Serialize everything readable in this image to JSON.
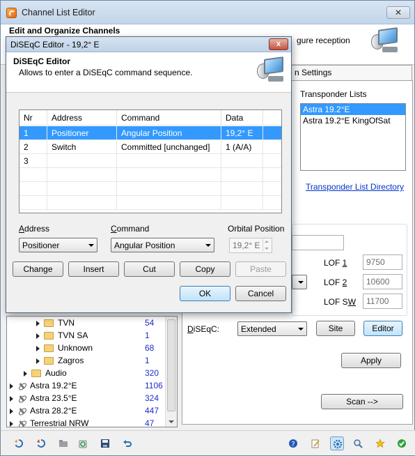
{
  "main": {
    "title": "Channel List Editor",
    "close_label": "✕",
    "header_title": "Edit and Organize Channels",
    "header_sub": "gure reception",
    "tab_label": "n Settings",
    "transponder_lists_label": "Transponder Lists",
    "transponder_lists": [
      "Astra 19.2°E",
      "Astra 19.2°E KingOfSat"
    ],
    "transponder_dir_link": "Transponder List Directory",
    "lof1_label_pre": "LOF ",
    "lof1_label_u": "1",
    "lof1_value": "9750",
    "lof2_label_pre": "LOF ",
    "lof2_label_u": "2",
    "lof2_value": "10600",
    "lofsw_label_pre": "LOF S",
    "lofsw_label_u": "W",
    "lofsw_value": "11700",
    "diseqc_label_u": "D",
    "diseqc_label_rest": "iSEqC:",
    "diseqc_value": "Extended",
    "site_button": "Site",
    "editor_button": "Editor",
    "apply_button": "Apply",
    "scan_button": "Scan -->"
  },
  "tree": {
    "rows": [
      {
        "label": "TVN",
        "count": "54"
      },
      {
        "label": "TVN SA",
        "count": "1"
      },
      {
        "label": "Unknown",
        "count": "68"
      },
      {
        "label": "Zagros",
        "count": "1"
      },
      {
        "label": "Audio",
        "count": "320"
      },
      {
        "label": "Astra 19.2°E",
        "count": "1106"
      },
      {
        "label": "Astra 23.5°E",
        "count": "324"
      },
      {
        "label": "Astra 28.2°E",
        "count": "447"
      },
      {
        "label": "Terrestrial NRW",
        "count": "47"
      }
    ]
  },
  "toolbar": {
    "icons": [
      "refresh-icon",
      "refresh-alt-icon",
      "folder-icon",
      "recycle-icon",
      "save-icon",
      "undo-icon",
      "help-icon",
      "edit-icon",
      "settings-icon",
      "search-icon",
      "favorite-star-icon",
      "ok-check-icon"
    ]
  },
  "dialog": {
    "title": "DiSEqC Editor - 19,2° E",
    "close_label": "x",
    "heading": "DiSEqC Editor",
    "description": "Allows to enter a DiSEqC command sequence.",
    "columns": [
      "Nr",
      "Address",
      "Command",
      "Data"
    ],
    "rows": [
      {
        "nr": "1",
        "address": "Positioner",
        "command": "Angular Position",
        "data": "19,2° E"
      },
      {
        "nr": "2",
        "address": "Switch",
        "command": "Committed [unchanged]",
        "data": "1  (A/A)"
      },
      {
        "nr": "3",
        "address": "",
        "command": "",
        "data": ""
      }
    ],
    "address_label_u": "A",
    "address_label_rest": "ddress",
    "address_value": "Positioner",
    "command_label_u": "C",
    "command_label_rest": "ommand",
    "command_value": "Angular Position",
    "orbital_label": "Orbital Position",
    "orbital_value": "19,2° E",
    "buttons": {
      "change": "Change",
      "insert": "Insert",
      "cut": "Cut",
      "copy": "Copy",
      "paste": "Paste",
      "ok": "OK",
      "cancel": "Cancel"
    }
  }
}
